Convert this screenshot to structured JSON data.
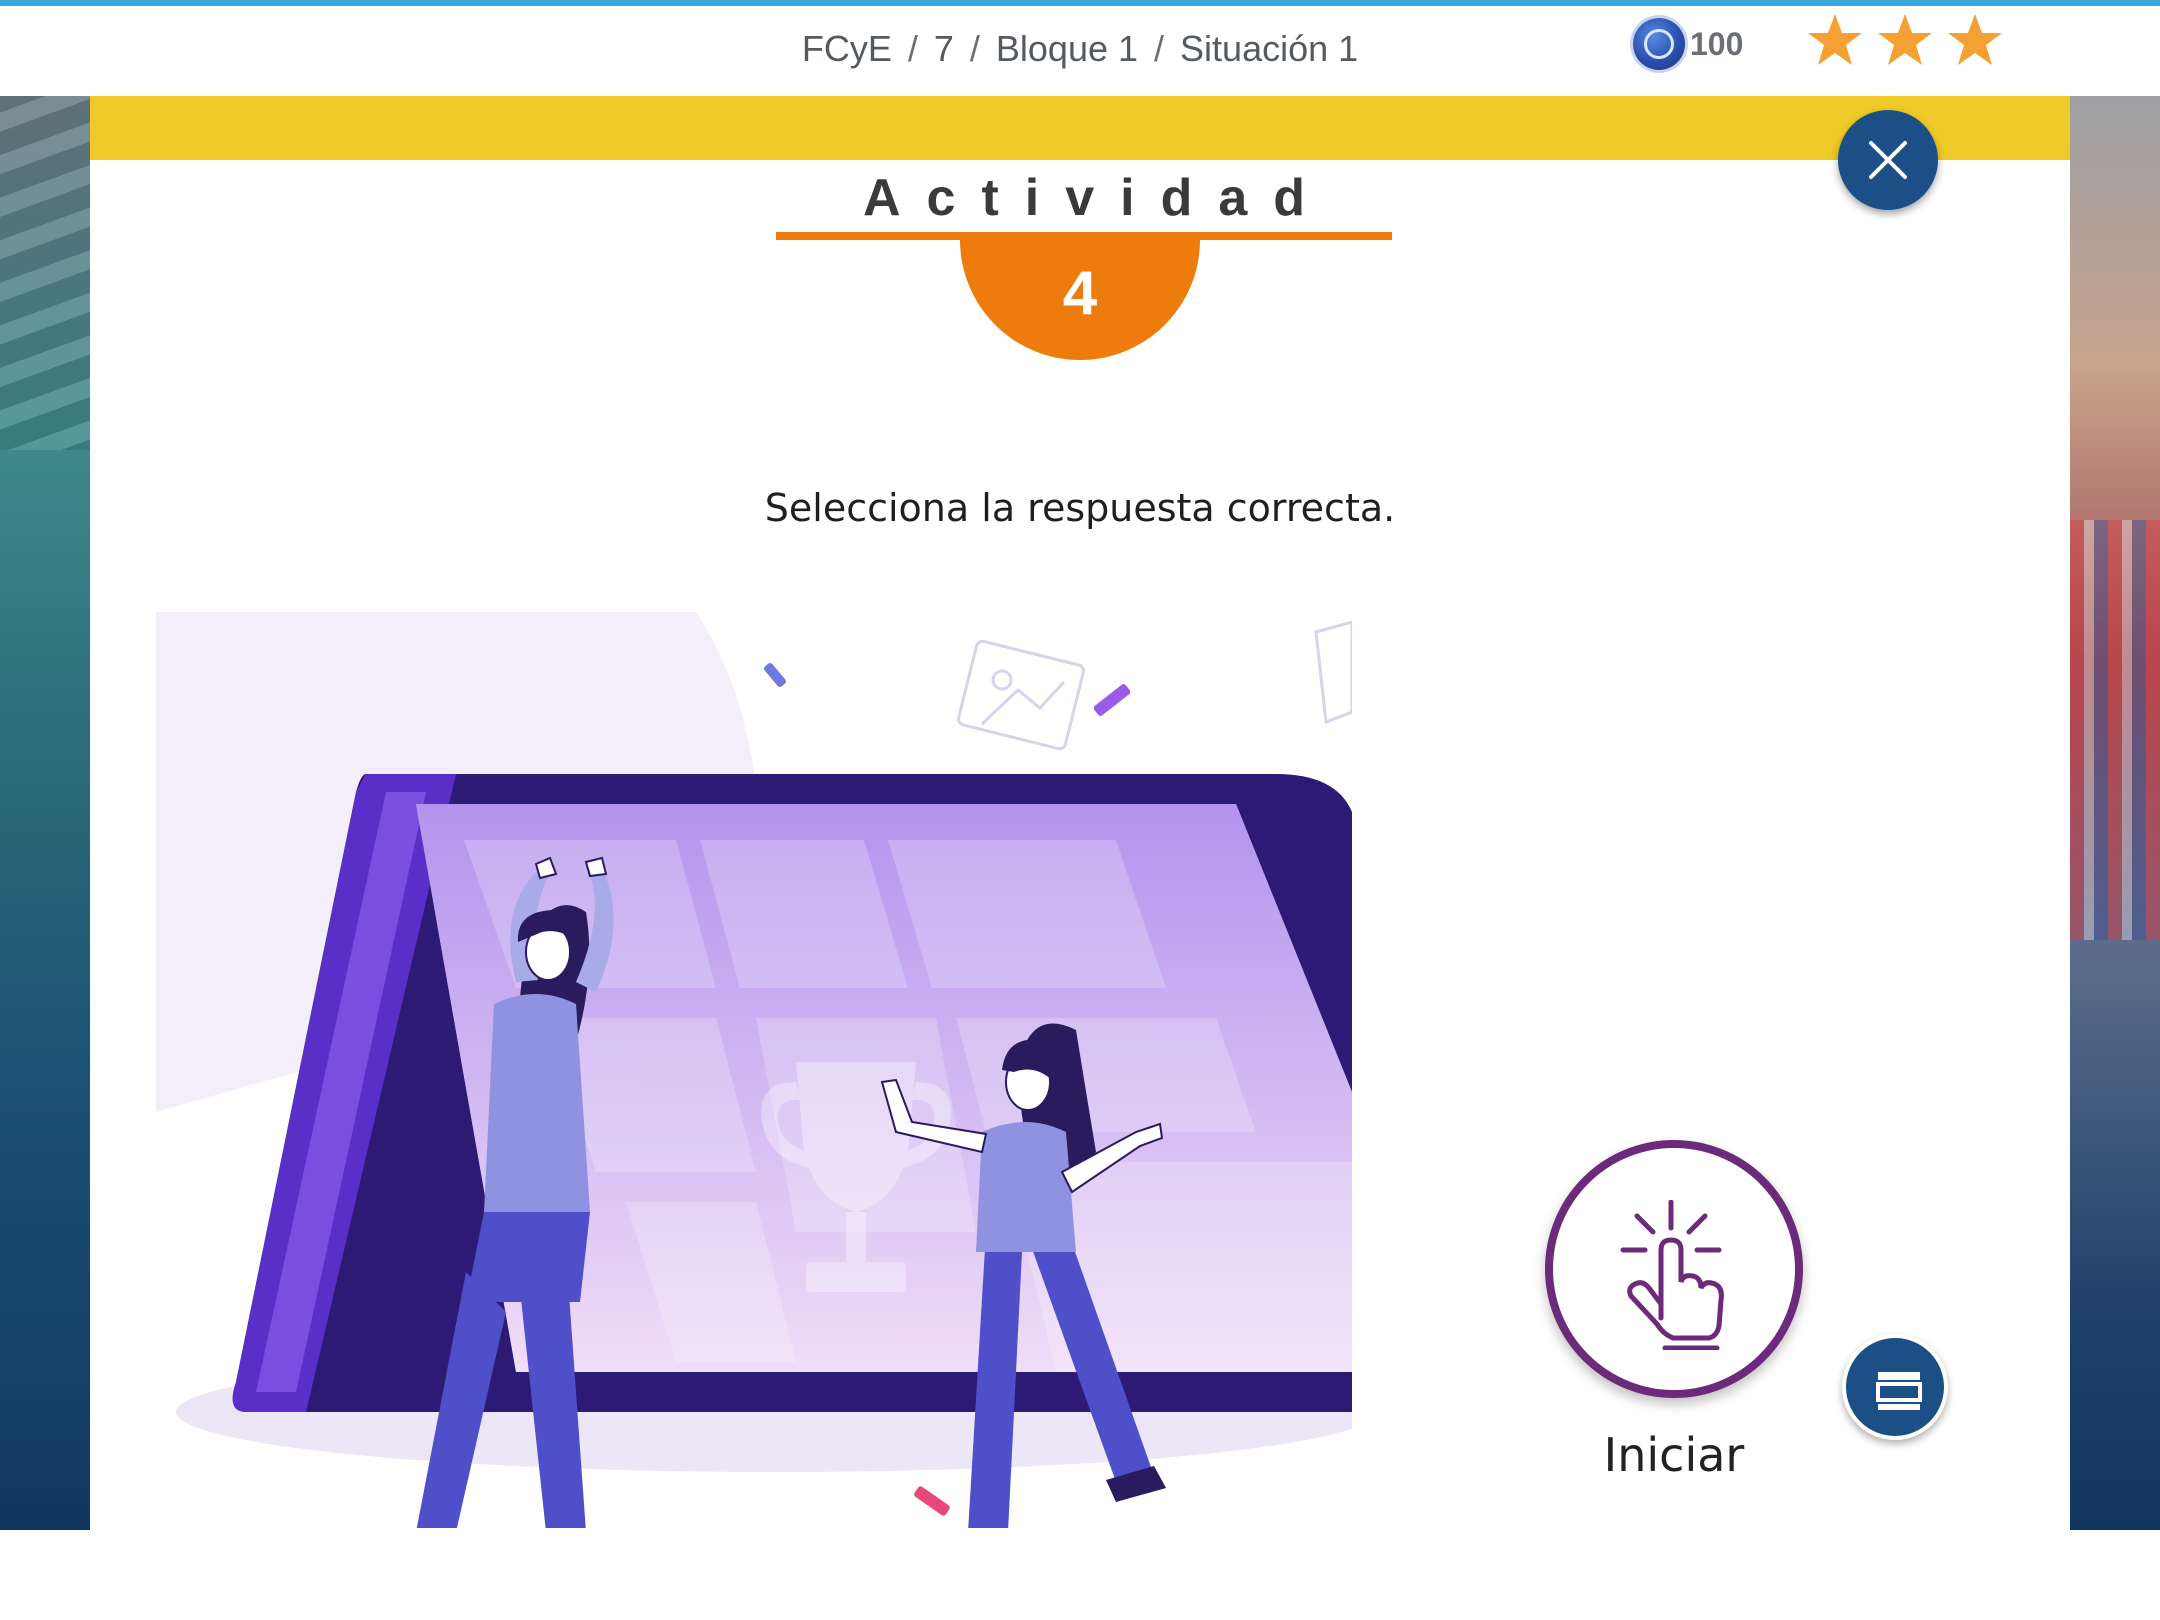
{
  "breadcrumb": {
    "subject": "FCyE",
    "grade": "7",
    "block": "Bloque 1",
    "situation": "Situación 1",
    "separator": "/"
  },
  "score": {
    "points": "100",
    "coin_icon": "medal-coin-icon",
    "stars": 3,
    "star_color": "#f5a033"
  },
  "activity": {
    "title": "Actividad",
    "number": "4",
    "accent_color": "#ee7c0c",
    "band_color": "#efc928"
  },
  "instruction": "Selecciona la respuesta correcta.",
  "actions": {
    "close_icon": "close-icon",
    "start_label": "Iniciar",
    "start_icon": "tap-hand-icon",
    "layout_icon": "layout-panel-icon",
    "primary_color": "#1c4f86",
    "start_ring_color": "#6b2a7a"
  },
  "illustration": {
    "subject": "two-people-celebrating-trophy-tablet",
    "trophy_icon": "trophy-icon"
  }
}
